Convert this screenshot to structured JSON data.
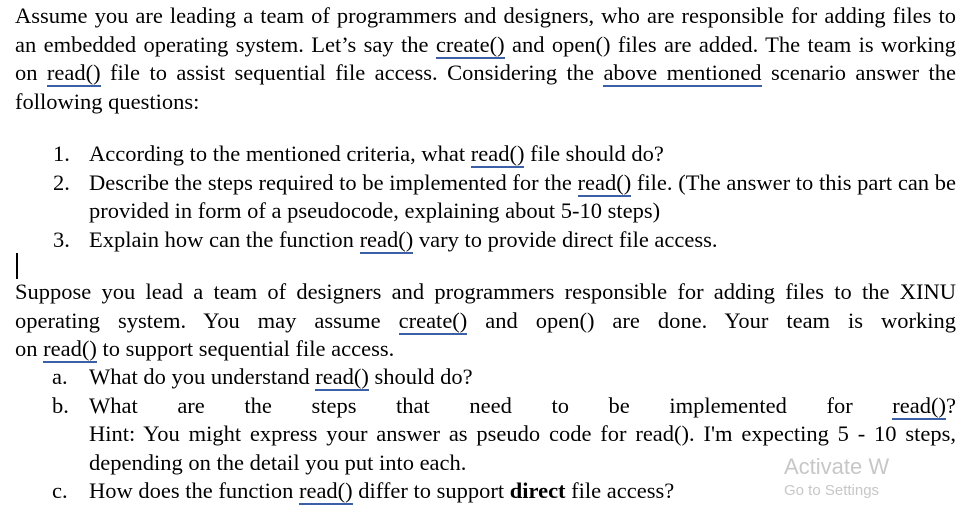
{
  "document": {
    "intro_paragraph": {
      "segments": [
        {
          "type": "text",
          "value": "Assume you are leading a team of programmers and designers, who are responsible for adding files to an embedded operating system. Let’s say the "
        },
        {
          "type": "underlined",
          "value": "create()"
        },
        {
          "type": "text",
          "value": " and open() files are added. The team is working on "
        },
        {
          "type": "underlined",
          "value": "read()"
        },
        {
          "type": "text",
          "value": " file to assist sequential file access. Considering the "
        },
        {
          "type": "underlined",
          "value": "above mentioned"
        },
        {
          "type": "text",
          "value": " scenario answer the following questions:"
        }
      ],
      "plain": "Assume you are leading a team of programmers and designers, who are responsible for adding files to an embedded operating system. Let’s say the create() and open() files are added. The team is working on read() file to assist sequential file access. Considering the above mentioned scenario answer the following questions:"
    },
    "numbered_list": [
      {
        "marker": "1.",
        "pre": "According to the mentioned criteria, what ",
        "underlined": "read()",
        "post": " file should do?"
      },
      {
        "marker": "2.",
        "pre": "Describe the steps required to be implemented for the ",
        "underlined": "read()",
        "post": " file. (The answer to this part can be provided in form of a pseudocode, explaining about 5-10 steps)"
      },
      {
        "marker": "3.",
        "pre": "Explain how can the function ",
        "underlined": "read()",
        "post": " vary to provide direct file access."
      }
    ],
    "second_paragraph": {
      "line1": "Suppose you lead a team of designers and programmers responsible for adding files to the XINU",
      "line2_pre": "operating system. You may assume ",
      "line2_underlined": "create()",
      "line2_post": " and open() are done. Your team is working",
      "line3_pre": "on ",
      "line3_underlined": "read()",
      "line3_post": " to support sequential file access.",
      "plain": "Suppose you lead a team of designers and programmers responsible for adding files to the XINU operating system. You may assume create() and open() are done. Your team is working on read() to support sequential file access."
    },
    "letter_list": [
      {
        "marker": "a.",
        "pre": "What do you understand ",
        "underlined": "read()",
        "post": " should do?"
      },
      {
        "marker": "b.",
        "line1_pre": "What are the steps that need to be implemented for ",
        "line1_underlined": "read()",
        "line1_post": "?",
        "line2": "Hint: You might express your answer as pseudo code for read(). I'm expecting 5 - 10 steps,",
        "line3": "depending on the detail you put into each."
      },
      {
        "marker": "c.",
        "pre": "How does the function ",
        "underlined": "read()",
        "mid": " differ to support ",
        "bold": "direct",
        "post": " file access?"
      }
    ]
  },
  "watermark": {
    "title": "Activate W",
    "subtitle": "Go to Settings"
  },
  "colors": {
    "underline": "#3b60a8",
    "text": "#000000",
    "watermark": "#c7c7c7",
    "background": "#ffffff"
  }
}
